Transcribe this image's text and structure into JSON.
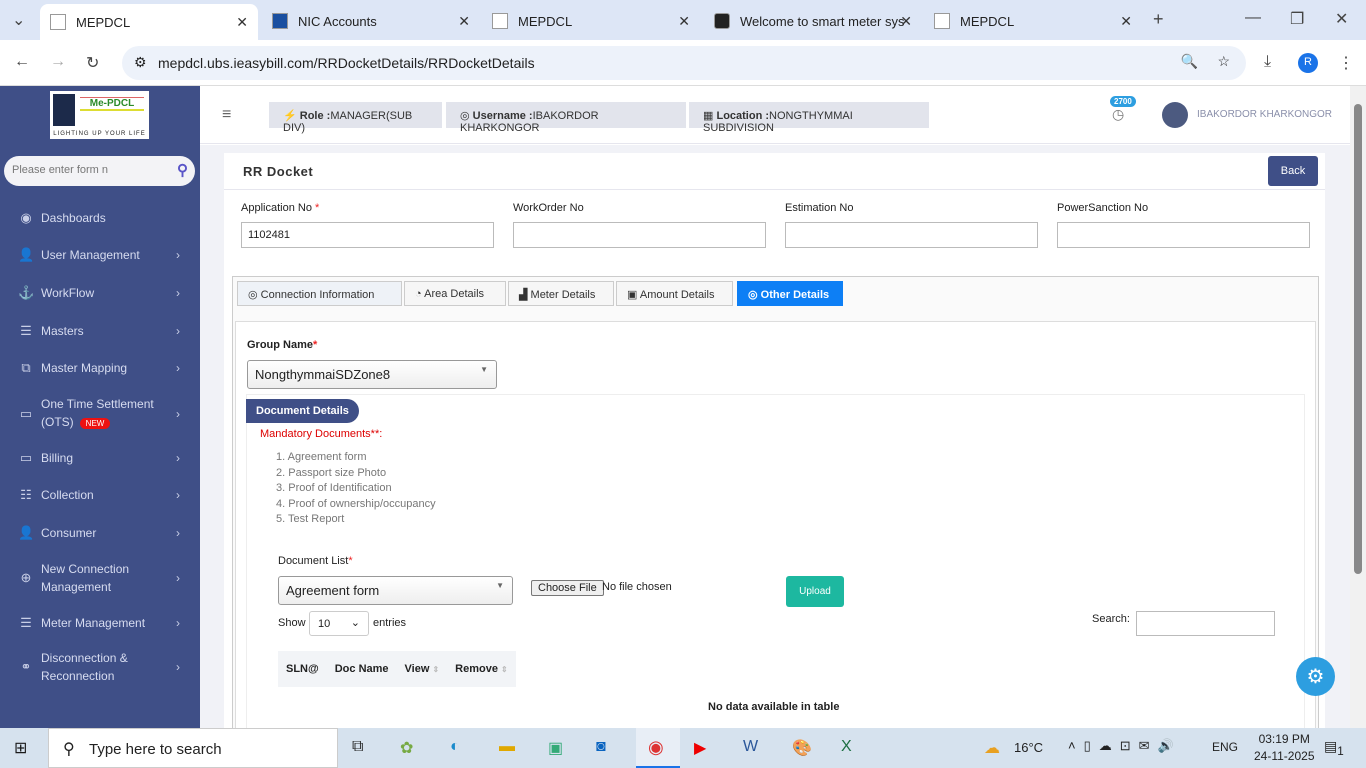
{
  "browser": {
    "tabs": [
      {
        "title": "MEPDCL"
      },
      {
        "title": "NIC Accounts"
      },
      {
        "title": "MEPDCL"
      },
      {
        "title": "Welcome to smart meter sys"
      },
      {
        "title": "MEPDCL"
      }
    ],
    "url": "mepdcl.ubs.ieasybill.com/RRDocketDetails/RRDocketDetails",
    "profile": "R"
  },
  "sidebar": {
    "logo_text": "Me-PDCL",
    "logo_tagline": "LIGHTING UP YOUR LIFE",
    "search_placeholder": "Please enter form n",
    "new_badge": "NEW",
    "items": [
      {
        "label": "Dashboards",
        "icon": "dashboard-icon"
      },
      {
        "label": "User Management",
        "icon": "user-icon"
      },
      {
        "label": "WorkFlow",
        "icon": "anchor-icon"
      },
      {
        "label": "Masters",
        "icon": "list-icon"
      },
      {
        "label": "Master Mapping",
        "icon": "sitemap-icon"
      },
      {
        "label": "One Time Settlement (OTS)",
        "icon": "monitor-icon"
      },
      {
        "label": "Billing",
        "icon": "monitor-icon"
      },
      {
        "label": "Collection",
        "icon": "list-icon"
      },
      {
        "label": "Consumer",
        "icon": "user-icon"
      },
      {
        "label": "New Connection Management",
        "icon": "plus-circle-icon"
      },
      {
        "label": "Meter Management",
        "icon": "list-icon"
      },
      {
        "label": "Disconnection & Reconnection",
        "icon": "link-icon"
      }
    ]
  },
  "header": {
    "role_label": "Role :",
    "role": "MANAGER(SUB DIV)",
    "username_label": "Username :",
    "username": "IBAKORDOR KHARKONGOR",
    "location_label": "Location :",
    "location": "NONGTHYMMAI SUBDIVISION",
    "notif_count": "2700",
    "user_name": "IBAKORDOR KHARKONGOR"
  },
  "page": {
    "title": "RR Docket",
    "back": "Back",
    "fields": {
      "application_no_label": "Application No",
      "application_no": "1102481",
      "workorder_label": "WorkOrder No",
      "estimation_label": "Estimation No",
      "powersanction_label": "PowerSanction No",
      "required": "*"
    },
    "tabs": [
      "Connection Information",
      "Area Details",
      "Meter Details",
      "Amount Details",
      "Other Details"
    ],
    "group_name_label": "Group Name",
    "group_name": "NongthymmaiSDZone8",
    "doc_details": "Document Details",
    "mandatory": "Mandatory Documents**:",
    "documents": [
      "1. Agreement form",
      "2. Passport size Photo",
      "3. Proof of Identification",
      "4. Proof of ownership/occupancy",
      "5. Test Report"
    ],
    "doc_list_label": "Document List",
    "doc_list_value": "Agreement form",
    "choose_file": "Choose File",
    "no_file": "No file chosen",
    "upload": "Upload",
    "show": "Show",
    "entries_value": "10",
    "entries": "entries",
    "search_label": "Search:",
    "columns": [
      "SLN@",
      "Doc Name",
      "View",
      "Remove"
    ],
    "empty": "No data available in table"
  },
  "taskbar": {
    "search": "Type here to search",
    "weather": "16°C",
    "lang": "ENG",
    "time": "03:19 PM",
    "date": "24-11-2025",
    "notif": "1"
  }
}
